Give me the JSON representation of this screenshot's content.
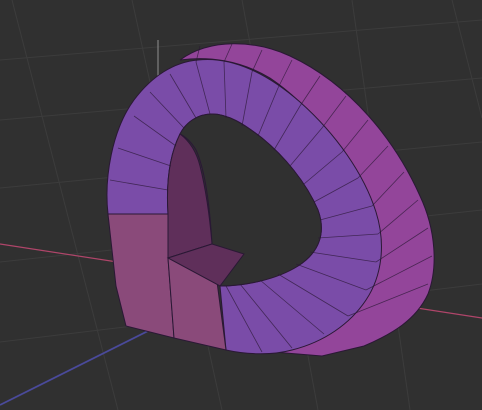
{
  "viewport": {
    "background_color": "#303030",
    "grid_color": "#3c3c3c",
    "axis_x_color": "#b0456a",
    "axis_y_color": "#4a4a9a",
    "axis_z_color": "#8f8f8f"
  },
  "object": {
    "shape": "arch-ring",
    "front_color": "#7a4ca8",
    "side_color": "#93459a",
    "inner_color": "#5f2f5a",
    "lower_block_color": "#8a4a7a",
    "edge_color": "#2a1835"
  }
}
